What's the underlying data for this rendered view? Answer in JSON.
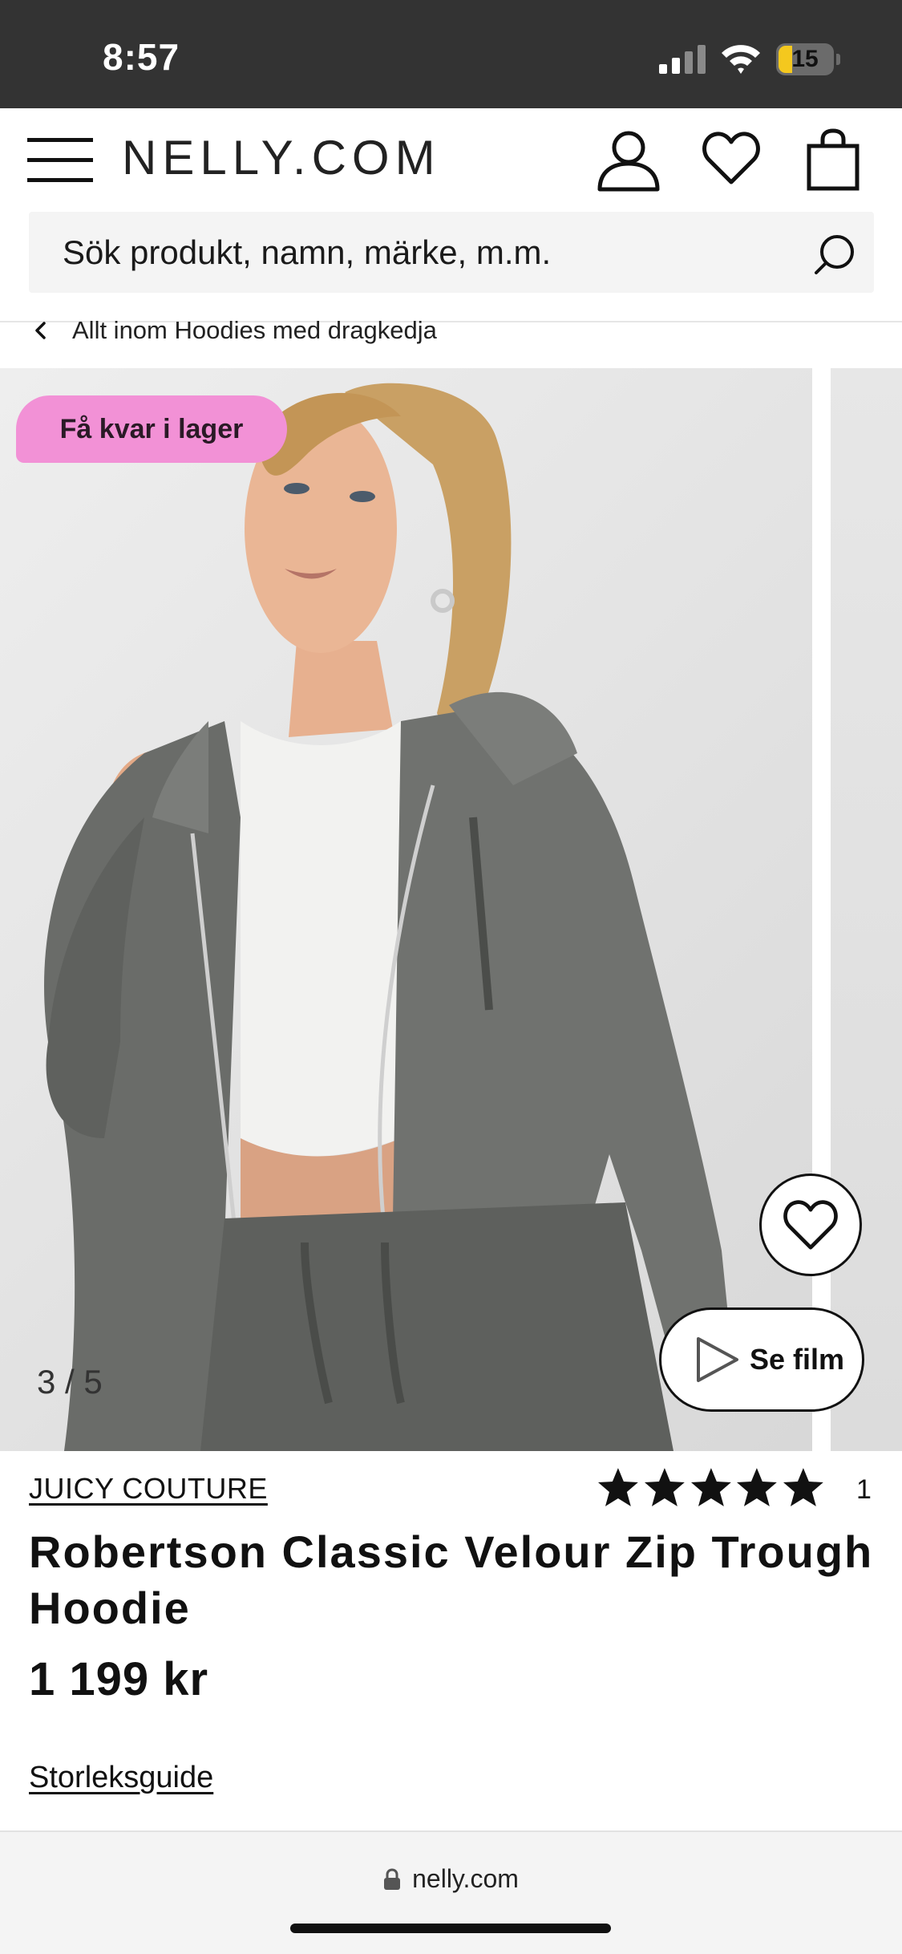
{
  "status_bar": {
    "time": "8:57",
    "battery": "15"
  },
  "header": {
    "logo": "NELLY.COM"
  },
  "search": {
    "placeholder": "Sök produkt, namn, märke, m.m."
  },
  "breadcrumb": {
    "label": "Allt inom Hoodies med dragkedja"
  },
  "gallery": {
    "badge": "Få kvar i lager",
    "counter": "3 / 5",
    "film_label": "Se film"
  },
  "product": {
    "brand": "JUICY COUTURE",
    "rating": 5,
    "rating_count": "1",
    "title": "Robertson Classic Velour Zip Trough Hoodie",
    "price": "1 199 kr",
    "size_guide": "Storleksguide"
  },
  "browser": {
    "url": "nelly.com"
  },
  "colors": {
    "badge": "#f291d6",
    "status_bar": "#333333",
    "battery_fill": "#f4c81e"
  }
}
